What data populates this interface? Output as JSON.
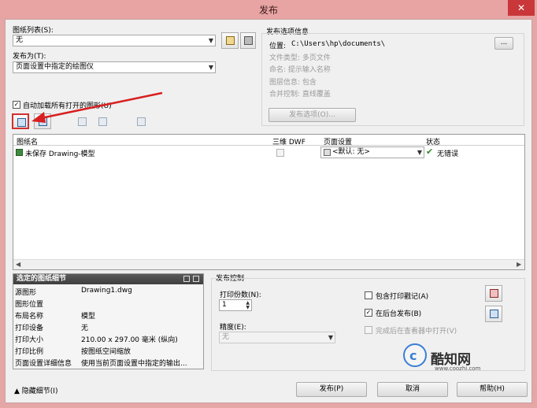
{
  "window": {
    "title": "发布",
    "close": "✕"
  },
  "sheet_list": {
    "label": "图纸列表(S):",
    "value": "无"
  },
  "publish_to": {
    "label": "发布为(T):",
    "value": "页面设置中指定的绘图仪"
  },
  "options_info": {
    "title": "发布选项信息",
    "location_label": "位置:",
    "location_value": "C:\\Users\\hp\\documents\\",
    "browse": "...",
    "file_type": "文件类型: 多页文件",
    "naming": "命名: 提示输入名称",
    "layer_info": "图层信息: 包含",
    "merge": "合并控制: 直线覆盖",
    "options_button": "发布选项(O)..."
  },
  "auto_load": {
    "label": "自动加载所有打开的图形(U)",
    "checked": "✓"
  },
  "sheet_table": {
    "headers": {
      "name": "图纸名",
      "dwf3d": "三维 DWF",
      "page_setup": "页面设置",
      "status": "状态"
    },
    "rows": [
      {
        "name": "未保存 Drawing-模型",
        "page_setup": "<默认: 无>",
        "status": "无错误"
      }
    ]
  },
  "details": {
    "title": "选定的图纸细节",
    "rows": [
      {
        "label": "源图形",
        "value": "Drawing1.dwg"
      },
      {
        "label": "图形位置",
        "value": ""
      },
      {
        "label": "布局名称",
        "value": "模型"
      },
      {
        "label": "打印设备",
        "value": "无"
      },
      {
        "label": "打印大小",
        "value": "210.00 x 297.00 毫米 (纵向)"
      },
      {
        "label": "打印比例",
        "value": "按图纸空间缩放"
      },
      {
        "label": "页面设置详细信息",
        "value": "使用当前页面设置中指定的输出..."
      }
    ]
  },
  "publish_control": {
    "title": "发布控制",
    "copies_label": "打印份数(N):",
    "copies_value": "1",
    "precision_label": "精度(E):",
    "precision_value": "无",
    "include_stamp": "包含打印戳记(A)",
    "background": "在后台发布(B)",
    "background_checked": "✓",
    "open_viewer": "完成后在查看器中打开(V)"
  },
  "footer": {
    "hide_details": "▲ 隐藏细节(I)",
    "publish": "发布(P)",
    "cancel": "取消",
    "help": "帮助(H)"
  },
  "watermark": {
    "brand": "酷知网",
    "url": "www.coozhi.com"
  }
}
